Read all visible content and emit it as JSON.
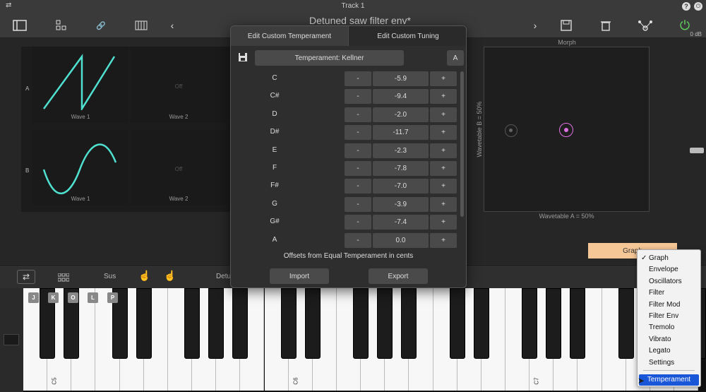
{
  "window": {
    "title": "Track 1"
  },
  "toolbar": {
    "preset_name": "Detuned saw filter env*",
    "db_readout": "0 dB"
  },
  "oscillators": {
    "row_a": "A",
    "row_b": "B",
    "cells": [
      {
        "label": "Wave 1",
        "off": ""
      },
      {
        "label": "Wave 2",
        "off": "Off"
      },
      {
        "label": "Wave 1",
        "off": ""
      },
      {
        "label": "Wave 2",
        "off": "Off"
      }
    ]
  },
  "morph": {
    "title": "Morph",
    "y_label": "Wavetable B = 50%",
    "x_label": "Wavetable A = 50%"
  },
  "graph_button": "Graph",
  "bottombar": {
    "sus": "Sus",
    "detune": "Detu"
  },
  "keyboard": {
    "chips": [
      "J",
      "K",
      "O",
      "L",
      "P"
    ],
    "octaves": [
      "C5",
      "C6",
      "C7"
    ]
  },
  "modal": {
    "tabs": [
      "Edit Custom Temperament",
      "Edit Custom Tuning"
    ],
    "temperament_name": "Temperament: Kellner",
    "reference_note": "A",
    "minus": "-",
    "plus": "+",
    "rows": [
      {
        "note": "C",
        "value": "-5.9"
      },
      {
        "note": "C#",
        "value": "-9.4"
      },
      {
        "note": "D",
        "value": "-2.0"
      },
      {
        "note": "D#",
        "value": "-11.7"
      },
      {
        "note": "E",
        "value": "-2.3"
      },
      {
        "note": "F",
        "value": "-7.8"
      },
      {
        "note": "F#",
        "value": "-7.0"
      },
      {
        "note": "G",
        "value": "-3.9"
      },
      {
        "note": "G#",
        "value": "-7.4"
      },
      {
        "note": "A",
        "value": "0.0"
      }
    ],
    "footnote": "Offsets from Equal Temperament in cents",
    "import": "Import",
    "export": "Export"
  },
  "menu": {
    "items": [
      "Graph",
      "Envelope",
      "Oscillators",
      "Filter",
      "Filter Mod",
      "Filter Env",
      "Tremolo",
      "Vibrato",
      "Legato",
      "Settings"
    ],
    "checked": "✓",
    "selected": "Temperament"
  },
  "colors": {
    "accent_cyan": "#4fe0d0",
    "morph_pink": "#e070e0",
    "graph_orange": "#f6c796",
    "key_highlight": "#1a73e8",
    "menu_selected": "#1a56d8"
  }
}
